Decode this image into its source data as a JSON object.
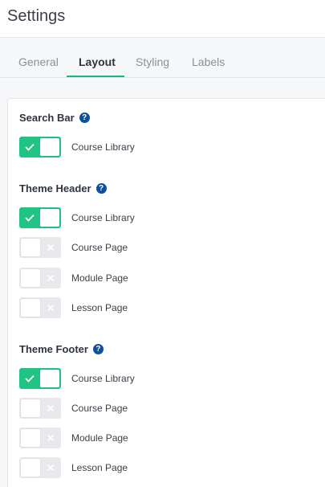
{
  "header": {
    "title": "Settings"
  },
  "tabs": [
    {
      "label": "General",
      "active": false
    },
    {
      "label": "Layout",
      "active": true
    },
    {
      "label": "Styling",
      "active": false
    },
    {
      "label": "Labels",
      "active": false
    }
  ],
  "sections": [
    {
      "title": "Search Bar",
      "help_icon": "question-circle-icon",
      "items": [
        {
          "label": "Course Library",
          "enabled": true
        }
      ]
    },
    {
      "title": "Theme Header",
      "help_icon": "question-circle-icon",
      "items": [
        {
          "label": "Course Library",
          "enabled": true
        },
        {
          "label": "Course Page",
          "enabled": false
        },
        {
          "label": "Module Page",
          "enabled": false
        },
        {
          "label": "Lesson Page",
          "enabled": false
        }
      ]
    },
    {
      "title": "Theme Footer",
      "help_icon": "question-circle-icon",
      "items": [
        {
          "label": "Course Library",
          "enabled": true
        },
        {
          "label": "Course Page",
          "enabled": false
        },
        {
          "label": "Module Page",
          "enabled": false
        },
        {
          "label": "Lesson Page",
          "enabled": false
        }
      ]
    }
  ],
  "colors": {
    "accent": "#1db57f",
    "toggle_on": "#20c585",
    "toggle_off": "#e7e9ec",
    "help_icon": "#0d4f9c"
  }
}
